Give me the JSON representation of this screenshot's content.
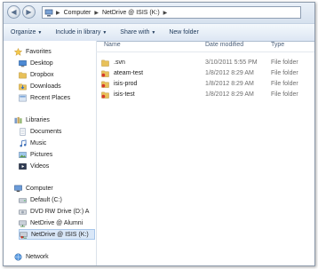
{
  "address": {
    "crumbs": [
      "Computer",
      "NetDrive @ ISIS (K:)"
    ]
  },
  "toolbar": {
    "organize": "Organize",
    "include": "Include in library",
    "share": "Share with",
    "newfolder": "New folder"
  },
  "nav": {
    "favorites": "Favorites",
    "desktop": "Desktop",
    "dropbox": "Dropbox",
    "downloads": "Downloads",
    "recent": "Recent Places",
    "libraries": "Libraries",
    "documents": "Documents",
    "music": "Music",
    "pictures": "Pictures",
    "videos": "Videos",
    "computer": "Computer",
    "drive_c": "Default (C:)",
    "drive_d": "DVD RW Drive (D:) A",
    "alumni": "NetDrive @ Alumni",
    "isis": "NetDrive @ ISIS (K:)",
    "network": "Network"
  },
  "columns": {
    "name": "Name",
    "date": "Date modified",
    "type": "Type"
  },
  "files": [
    {
      "name": ".svn",
      "date": "3/10/2011 5:55 PM",
      "type": "File folder"
    },
    {
      "name": "ateam-test",
      "date": "1/8/2012 8:29 AM",
      "type": "File folder"
    },
    {
      "name": "isis-prod",
      "date": "1/8/2012 8:29 AM",
      "type": "File folder"
    },
    {
      "name": "isis-test",
      "date": "1/8/2012 8:29 AM",
      "type": "File folder"
    }
  ],
  "colors": {
    "folder": "#e8c15a",
    "selection": "#d9e7f8",
    "toolbar_text": "#1e395b"
  }
}
